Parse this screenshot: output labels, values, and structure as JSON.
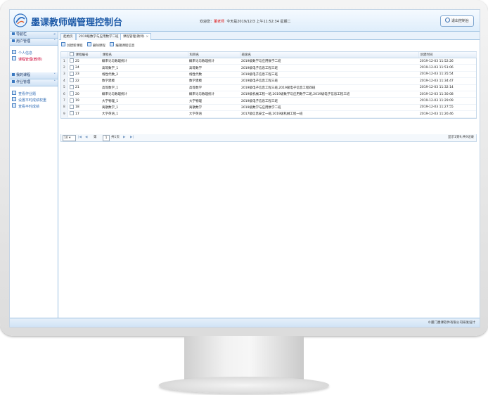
{
  "app": {
    "title": "墨课教师端管理控制台",
    "welcome_prefix": "欢迎您：",
    "user_name": "董老师",
    "datetime_text": "今天是2019/12/3 上午11:52:34 星期二",
    "exit_label": "退出控制台"
  },
  "sidebar": {
    "nav_header": "导航栏",
    "sections": [
      {
        "title": "用户管理",
        "items": [
          "个人信息",
          "课程管理(教师)"
        ]
      },
      {
        "title": "我的课程",
        "items": []
      },
      {
        "title": "作业管理",
        "items": [
          "查看作业题",
          "设置平时成绩权重",
          "查看平时成绩"
        ]
      }
    ]
  },
  "tabs": [
    {
      "label": "起始页",
      "closable": false
    },
    {
      "label": "2019级数学与应用数学二班",
      "closable": true
    },
    {
      "label": "课程管理(教师)",
      "closable": true
    }
  ],
  "toolbar": {
    "create": "创建新课程",
    "delete": "删除课程",
    "edit": "编辑课程信息"
  },
  "grid": {
    "headers": [
      "课程编号",
      "课程名",
      "科目名",
      "班级名",
      "创建时间"
    ],
    "rows": [
      [
        "25",
        "概率论与数理统计",
        "概率论与数理统计",
        "2019级数学与应用数学二班",
        "2019-12-03 11:52:26"
      ],
      [
        "24",
        "高等数学_1",
        "高等数学",
        "2019级电子信息工程三班",
        "2019-12-03 11:51:06"
      ],
      [
        "23",
        "线性代数_2",
        "线性代数",
        "2019级电子信息工程三班",
        "2019-12-03 11:35:54"
      ],
      [
        "22",
        "数学建模",
        "数学建模",
        "2019级电子信息工程三班",
        "2019-12-03 11:34:47"
      ],
      [
        "21",
        "高等数学_1",
        "高等数学",
        "2019级电子信息工程三班,2019级电子信息工程四班",
        "2019-12-03 11:32:14"
      ],
      [
        "20",
        "概率论与数理统计",
        "概率论与数理统计",
        "2019级机械工程一班,2019级数学与应用数学二班,2019级电子信息工程三班",
        "2019-12-03 11:30:08"
      ],
      [
        "19",
        "大学物理_1",
        "大学物理",
        "2019级电子信息工程三班",
        "2019-12-03 11:29:09"
      ],
      [
        "18",
        "离散数学_1",
        "离散数学",
        "2019级数学与应用数学二班",
        "2019-12-03 11:27:55"
      ],
      [
        "17",
        "大学英语_1",
        "大学英语",
        "2017级信息安全一班,2019级机械工程一班",
        "2019-12-03 11:26:46"
      ]
    ]
  },
  "pager": {
    "page_size": "10",
    "page_label": "第",
    "page_value": "1",
    "total_label": "共1页",
    "info": "显示1到9,共9记录"
  },
  "footer": {
    "copyright": "©厦门墨课软件有限公司研发设计"
  }
}
